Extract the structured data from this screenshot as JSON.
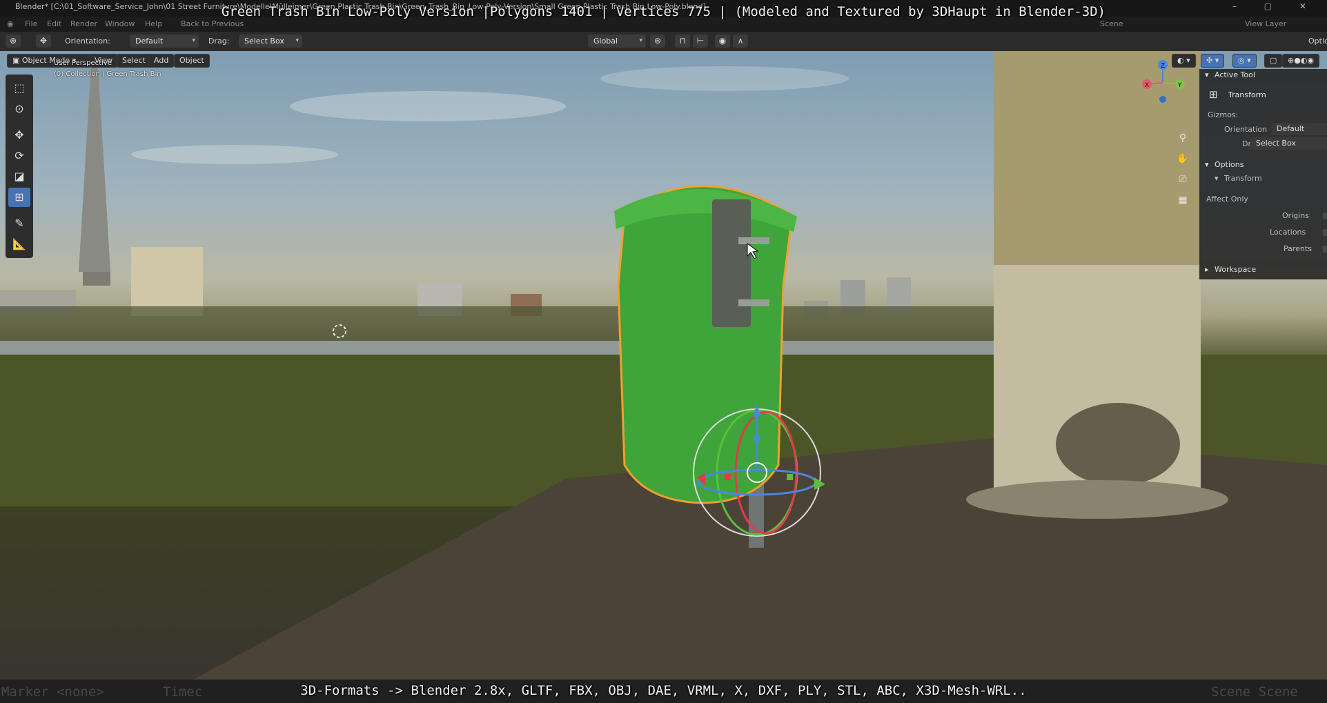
{
  "window": {
    "title_path": "Blender* [C:\\01_Software_Service_John\\01 Street Furniture\\Modelle\\Mülleimer\\Green Plastic Trash Bin\\Green_Trash_Bin_Low-Poly-Version\\Small Green Plastic Trash Bin Low-Poly.blend]",
    "controls": "– ▢ ✕"
  },
  "menu": {
    "items": [
      "File",
      "Edit",
      "Render",
      "Window",
      "Help"
    ],
    "back_button": "Back to Previous",
    "scene": "Scene",
    "view_layer": "View Layer"
  },
  "overlay": {
    "top_caption": "Green Trash Bin Low-Poly Version |Polygons 1401 | Vertices 775 | (Modeled and Textured by 3DHaupt in Blender-3D)",
    "bottom_caption": "3D-Formats -> Blender 2.8x, GLTF, FBX, OBJ, DAE, VRML, X, DXF, PLY, STL, ABC, X3D-Mesh-WRL..",
    "ghost_left": "Marker <none>",
    "ghost_mid": "Timec",
    "ghost_right": "Scene Scene"
  },
  "toolbar": {
    "orientation_label": "Orientation:",
    "orientation_value": "Default",
    "drag_label": "Drag:",
    "drag_value": "Select Box",
    "transform_orientation": "Global",
    "options_label": "Optic"
  },
  "viewport_header": {
    "mode": "Object Mode",
    "view": "View",
    "select": "Select",
    "add": "Add",
    "object": "Object"
  },
  "viewport": {
    "perspective": "User Perspective",
    "collection": "(0) Collection | Green Trash Bin",
    "axis_x": "X",
    "axis_y": "Y",
    "axis_z": "Z"
  },
  "npanel": {
    "active_tool_header": "Active Tool",
    "tool_name": "Transform",
    "gizmos_label": "Gizmos:",
    "orientation_label": "Orientation",
    "orientation_value": "Default",
    "drag_label": "Drag:",
    "drag_value": "Select Box",
    "options_header": "Options",
    "transform_sub": "Transform",
    "affect_only": "Affect Only",
    "origins": "Origins",
    "locations": "Locations",
    "parents": "Parents",
    "workspace_header": "Workspace"
  },
  "colors": {
    "accent": "#4772b3",
    "bin_green": "#3fa43a",
    "selection_outline": "#f0a030"
  }
}
